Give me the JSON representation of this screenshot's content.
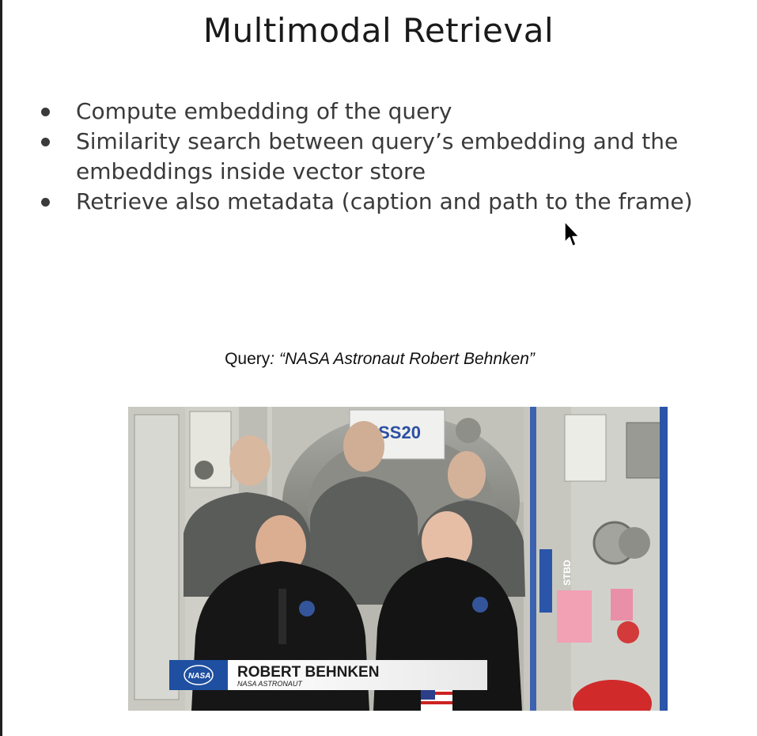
{
  "slide": {
    "title": "Multimodal Retrieval",
    "bullets": [
      {
        "text": "Compute embedding of the query"
      },
      {
        "text": "Similarity search between query’s embedding and the embeddings inside vector store"
      },
      {
        "text": "Retrieve also metadata (caption and path to the frame)"
      }
    ]
  },
  "query": {
    "prefix": "Query",
    "text": ": “NASA Astronaut Robert Behnken”"
  },
  "video_frame": {
    "lower_third_name": "ROBERT BEHNKEN",
    "lower_third_title": "NASA ASTRONAUT",
    "logo_text": "NASA",
    "banner_text": "ISS20",
    "stbd_text": "STBD"
  },
  "colors": {
    "text": "#3a3a3a",
    "title": "#1a1a1a",
    "nasa_blue": "#1f4fa0"
  },
  "icons": {
    "cursor": "mouse-pointer-icon"
  }
}
